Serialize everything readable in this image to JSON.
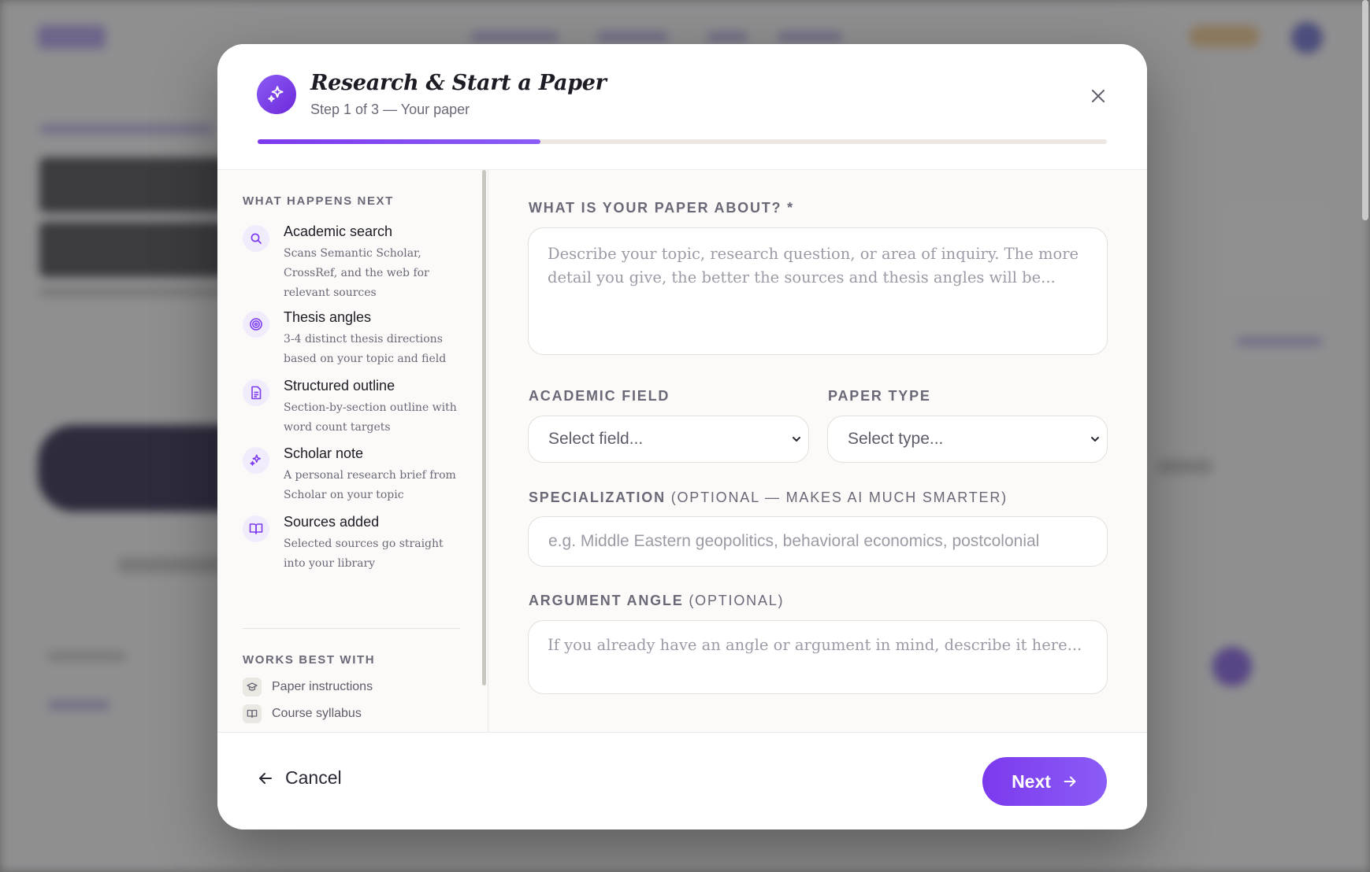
{
  "modal": {
    "title": "Research & Start a Paper",
    "subtitle": "Step 1 of 3 — Your paper",
    "progress_fraction": 0.333,
    "accent_color": "#7c3aed"
  },
  "sidebar": {
    "heading": "WHAT HAPPENS NEXT",
    "steps": [
      {
        "title": "Academic search",
        "description": "Scans Semantic Scholar, CrossRef, and the web for relevant sources",
        "icon": "search-icon"
      },
      {
        "title": "Thesis angles",
        "description": "3-4 distinct thesis directions based on your topic and field",
        "icon": "target-icon"
      },
      {
        "title": "Structured outline",
        "description": "Section-by-section outline with word count targets",
        "icon": "document-icon"
      },
      {
        "title": "Scholar note",
        "description": "A personal research brief from Scholar on your topic",
        "icon": "sparkle-icon"
      },
      {
        "title": "Sources added",
        "description": "Selected sources go straight into your library",
        "icon": "book-icon"
      }
    ],
    "works_heading": "WORKS BEST WITH",
    "works_items": [
      {
        "label": "Paper instructions",
        "icon": "graduation-cap-icon"
      },
      {
        "label": "Course syllabus",
        "icon": "book-icon"
      }
    ]
  },
  "form": {
    "topic_label": "WHAT IS YOUR PAPER ABOUT? *",
    "topic_placeholder": "Describe your topic, research question, or area of inquiry. The more detail you give, the better the sources and thesis angles will be...",
    "field_label": "ACADEMIC FIELD",
    "field_value": "Select field...",
    "type_label": "PAPER TYPE",
    "type_value": "Select type...",
    "specialization_label": "SPECIALIZATION",
    "specialization_optional": "(OPTIONAL — MAKES AI MUCH SMARTER)",
    "specialization_placeholder": "e.g. Middle Eastern geopolitics, behavioral economics, postcolonial",
    "angle_label": "ARGUMENT ANGLE",
    "angle_optional": "(OPTIONAL)",
    "angle_placeholder": "If you already have an angle or argument in mind, describe it here..."
  },
  "footer": {
    "cancel_label": "Cancel",
    "next_label": "Next"
  }
}
